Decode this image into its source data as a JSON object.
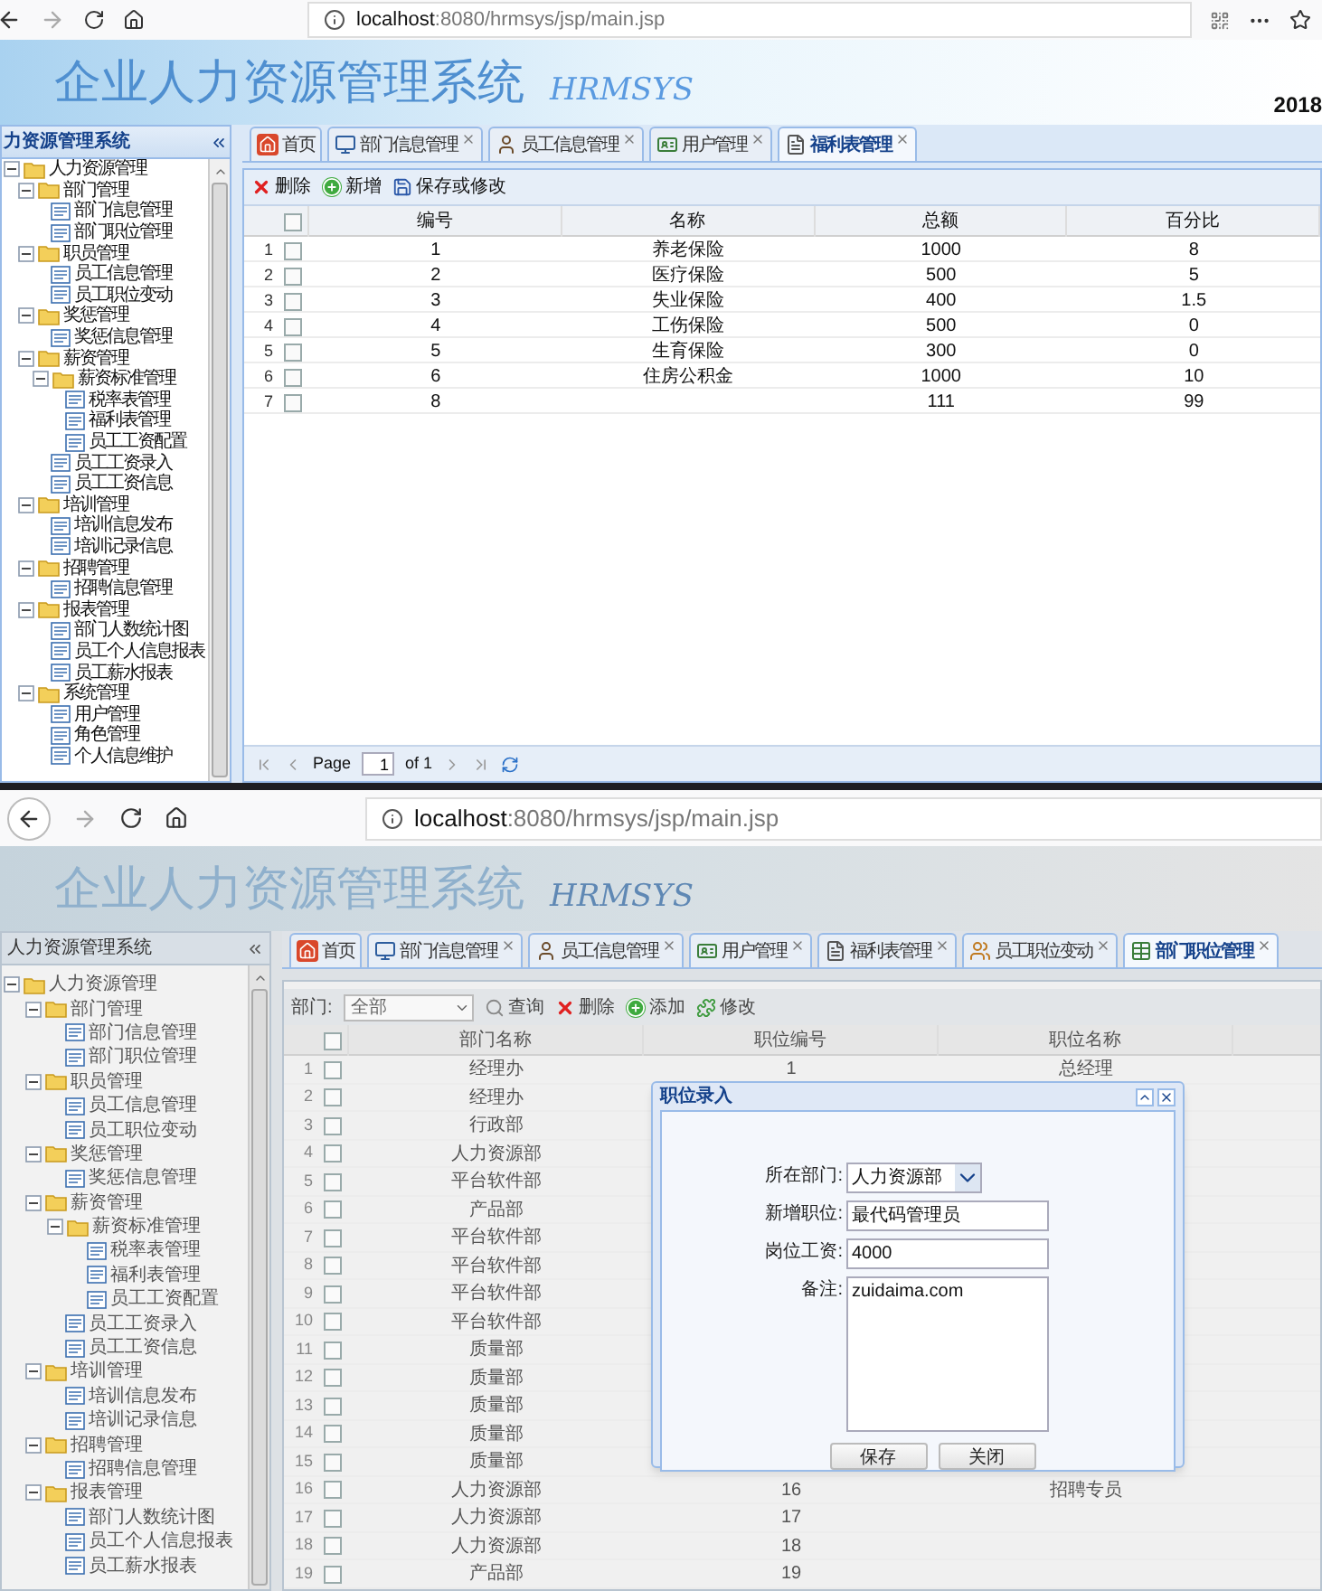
{
  "top_window": {
    "browser": {
      "url_host": "localhost",
      "url_rest": ":8080/hrmsys/jsp/main.jsp"
    },
    "banner": {
      "title": "企业人力资源管理系统",
      "subtitle": "HRMSYS",
      "date": "2018"
    },
    "sidebar": {
      "title": "力资源管理系统",
      "tree": [
        {
          "label": "人力资源管理",
          "expanded": true,
          "children": [
            {
              "label": "部门管理",
              "expanded": true,
              "children": [
                {
                  "label": "部门信息管理"
                },
                {
                  "label": "部门职位管理"
                }
              ]
            },
            {
              "label": "职员管理",
              "expanded": true,
              "children": [
                {
                  "label": "员工信息管理"
                },
                {
                  "label": "员工职位变动"
                }
              ]
            },
            {
              "label": "奖惩管理",
              "expanded": true,
              "children": [
                {
                  "label": "奖惩信息管理"
                }
              ]
            },
            {
              "label": "薪资管理",
              "expanded": true,
              "children": [
                {
                  "label": "薪资标准管理",
                  "expanded": true,
                  "children": [
                    {
                      "label": "税率表管理"
                    },
                    {
                      "label": "福利表管理"
                    },
                    {
                      "label": "员工工资配置"
                    }
                  ]
                },
                {
                  "label": "员工工资录入"
                },
                {
                  "label": "员工工资信息"
                }
              ]
            },
            {
              "label": "培训管理",
              "expanded": true,
              "children": [
                {
                  "label": "培训信息发布"
                },
                {
                  "label": "培训记录信息"
                }
              ]
            },
            {
              "label": "招聘管理",
              "expanded": true,
              "children": [
                {
                  "label": "招聘信息管理"
                }
              ]
            },
            {
              "label": "报表管理",
              "expanded": true,
              "children": [
                {
                  "label": "部门人数统计图"
                },
                {
                  "label": "员工个人信息报表"
                },
                {
                  "label": "员工薪水报表"
                }
              ]
            },
            {
              "label": "系统管理",
              "expanded": true,
              "children": [
                {
                  "label": "用户管理"
                },
                {
                  "label": "角色管理"
                },
                {
                  "label": "个人信息维护"
                }
              ]
            }
          ]
        }
      ]
    },
    "tabs": [
      {
        "label": "首页",
        "closable": false,
        "selected": false
      },
      {
        "label": "部门信息管理",
        "closable": true,
        "selected": false
      },
      {
        "label": "员工信息管理",
        "closable": true,
        "selected": false
      },
      {
        "label": "用户管理",
        "closable": true,
        "selected": false
      },
      {
        "label": "福利表管理",
        "closable": true,
        "selected": true
      }
    ],
    "toolbar": [
      {
        "kind": "delete",
        "label": "删除"
      },
      {
        "kind": "add",
        "label": "新增"
      },
      {
        "kind": "save",
        "label": "保存或修改"
      }
    ],
    "table": {
      "columns": [
        "编号",
        "名称",
        "总额",
        "百分比"
      ],
      "header_checked": false,
      "rows": [
        {
          "index": "1",
          "checked": false,
          "no": "1",
          "name": "养老保险",
          "total": "1000",
          "percent": "8"
        },
        {
          "index": "2",
          "checked": false,
          "no": "2",
          "name": "医疗保险",
          "total": "500",
          "percent": "5"
        },
        {
          "index": "3",
          "checked": false,
          "no": "3",
          "name": "失业保险",
          "total": "400",
          "percent": "1.5"
        },
        {
          "index": "4",
          "checked": false,
          "no": "4",
          "name": "工伤保险",
          "total": "500",
          "percent": "0"
        },
        {
          "index": "5",
          "checked": false,
          "no": "5",
          "name": "生育保险",
          "total": "300",
          "percent": "0"
        },
        {
          "index": "6",
          "checked": false,
          "no": "6",
          "name": "住房公积金",
          "total": "1000",
          "percent": "10"
        },
        {
          "index": "7",
          "checked": false,
          "no": "8",
          "total": "111",
          "percent": "99"
        }
      ]
    },
    "pager": {
      "page_label": "Page",
      "page": "1",
      "of": "of 1"
    }
  },
  "bottom_window": {
    "browser": {
      "url_host": "localhost",
      "url_rest": ":8080/hrmsys/jsp/main.jsp"
    },
    "banner": {
      "title": "企业人力资源管理系统",
      "subtitle": "HRMSYS"
    },
    "sidebar": {
      "title": "人力资源管理系统",
      "tree": [
        {
          "label": "人力资源管理",
          "expanded": true,
          "children": [
            {
              "label": "部门管理",
              "expanded": true,
              "children": [
                {
                  "label": "部门信息管理"
                },
                {
                  "label": "部门职位管理"
                }
              ]
            },
            {
              "label": "职员管理",
              "expanded": true,
              "children": [
                {
                  "label": "员工信息管理"
                },
                {
                  "label": "员工职位变动"
                }
              ]
            },
            {
              "label": "奖惩管理",
              "expanded": true,
              "children": [
                {
                  "label": "奖惩信息管理"
                }
              ]
            },
            {
              "label": "薪资管理",
              "expanded": true,
              "children": [
                {
                  "label": "薪资标准管理",
                  "expanded": true,
                  "children": [
                    {
                      "label": "税率表管理"
                    },
                    {
                      "label": "福利表管理"
                    },
                    {
                      "label": "员工工资配置"
                    }
                  ]
                },
                {
                  "label": "员工工资录入"
                },
                {
                  "label": "员工工资信息"
                }
              ]
            },
            {
              "label": "培训管理",
              "expanded": true,
              "children": [
                {
                  "label": "培训信息发布"
                },
                {
                  "label": "培训记录信息"
                }
              ]
            },
            {
              "label": "招聘管理",
              "expanded": true,
              "children": [
                {
                  "label": "招聘信息管理"
                }
              ]
            },
            {
              "label": "报表管理",
              "expanded": true,
              "children": [
                {
                  "label": "部门人数统计图"
                },
                {
                  "label": "员工个人信息报表"
                },
                {
                  "label": "员工薪水报表"
                }
              ]
            }
          ]
        }
      ]
    },
    "tabs": [
      {
        "label": "首页",
        "closable": false,
        "selected": false
      },
      {
        "label": "部门信息管理",
        "closable": true,
        "selected": false
      },
      {
        "label": "员工信息管理",
        "closable": true,
        "selected": false
      },
      {
        "label": "用户管理",
        "closable": true,
        "selected": false
      },
      {
        "label": "福利表管理",
        "closable": true,
        "selected": false
      },
      {
        "label": "员工职位变动",
        "closable": true,
        "selected": false
      },
      {
        "label": "部门职位管理",
        "closable": true,
        "selected": true
      }
    ],
    "filter": {
      "label": "部门:",
      "value": "全部"
    },
    "toolbar": [
      {
        "kind": "search",
        "label": "查询"
      },
      {
        "kind": "delete",
        "label": "删除"
      },
      {
        "kind": "add",
        "label": "添加"
      },
      {
        "kind": "edit",
        "label": "修改"
      }
    ],
    "table": {
      "columns": [
        "部门名称",
        "职位编号",
        "职位名称"
      ],
      "header_checked": false,
      "rows": [
        {
          "index": "1",
          "checked": false,
          "dept": "经理办",
          "position_no": "1",
          "position_name": "总经理"
        },
        {
          "index": "2",
          "checked": false,
          "dept": "经理办"
        },
        {
          "index": "3",
          "checked": false,
          "dept": "行政部"
        },
        {
          "index": "4",
          "checked": false,
          "dept": "人力资源部"
        },
        {
          "index": "5",
          "checked": false,
          "dept": "平台软件部"
        },
        {
          "index": "6",
          "checked": false,
          "dept": "产品部"
        },
        {
          "index": "7",
          "checked": false,
          "dept": "平台软件部"
        },
        {
          "index": "8",
          "checked": false,
          "dept": "平台软件部"
        },
        {
          "index": "9",
          "checked": false,
          "dept": "平台软件部"
        },
        {
          "index": "10",
          "checked": false,
          "dept": "平台软件部"
        },
        {
          "index": "11",
          "checked": false,
          "dept": "质量部"
        },
        {
          "index": "12",
          "checked": false,
          "dept": "质量部"
        },
        {
          "index": "13",
          "checked": false,
          "dept": "质量部"
        },
        {
          "index": "14",
          "checked": false,
          "dept": "质量部"
        },
        {
          "index": "15",
          "checked": false,
          "dept": "质量部"
        },
        {
          "index": "16",
          "checked": false,
          "dept": "人力资源部",
          "position_no": "16",
          "position_name": "招聘专员"
        },
        {
          "index": "17",
          "checked": false,
          "dept": "人力资源部",
          "position_no": "17"
        },
        {
          "index": "18",
          "checked": false,
          "dept": "人力资源部",
          "position_no": "18"
        },
        {
          "index": "19",
          "checked": false,
          "dept": "产品部",
          "position_no": "19"
        }
      ]
    },
    "dialog": {
      "title": "职位录入",
      "fields": [
        {
          "kind": "select",
          "label": "所在部门:",
          "value": "人力资源部"
        },
        {
          "kind": "text",
          "label": "新增职位:",
          "value": "最代码管理员"
        },
        {
          "kind": "text",
          "label": "岗位工资:",
          "value": "4000"
        },
        {
          "kind": "textarea",
          "label": "备注:",
          "value": "zuidaima.com"
        }
      ],
      "buttons": [
        "保存",
        "关闭"
      ]
    }
  }
}
